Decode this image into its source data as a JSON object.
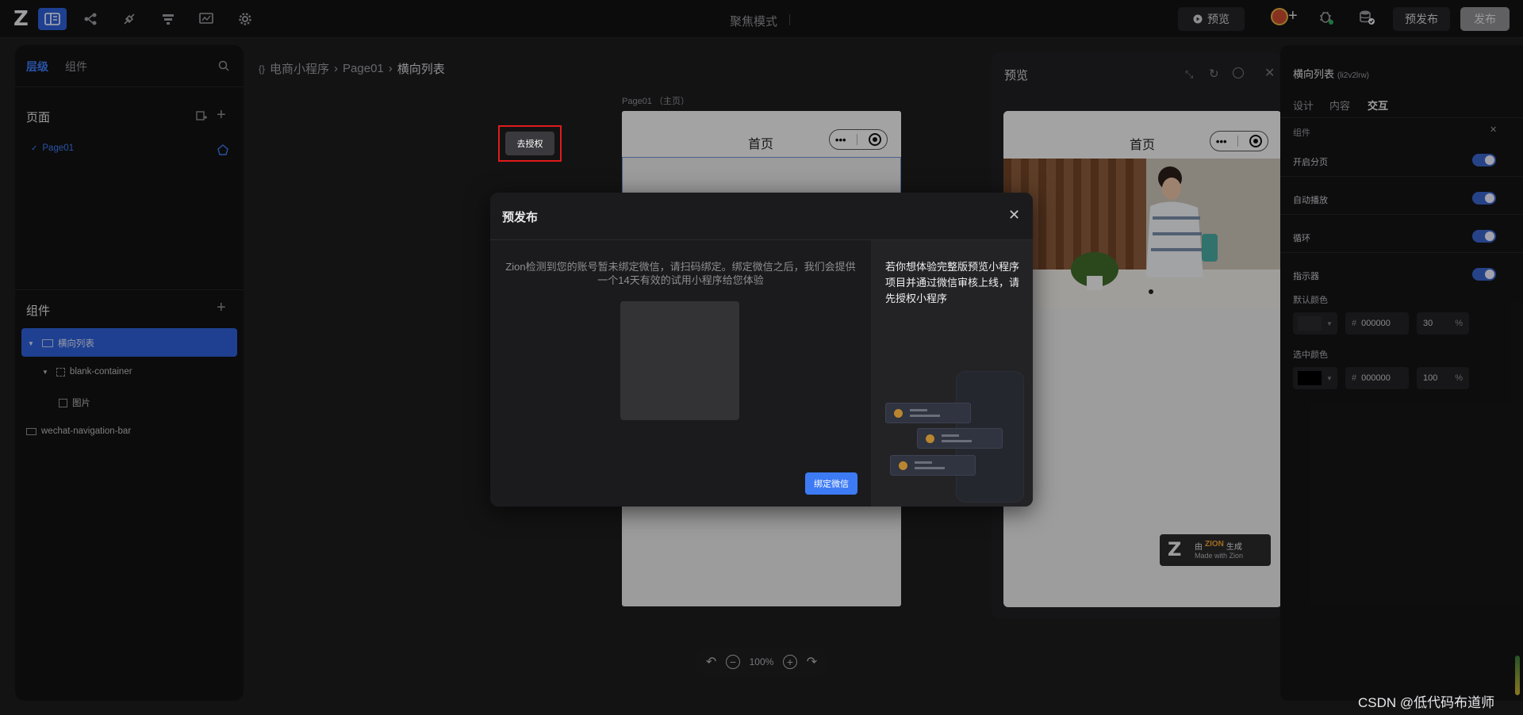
{
  "topbar": {
    "logo": "Z",
    "focus_mode": "聚焦模式",
    "preview_label": "预览",
    "prepublish_label": "预发布",
    "publish_label": "发布"
  },
  "left_panel": {
    "tabs": [
      "层级",
      "组件"
    ],
    "pages_title": "页面",
    "page_item": "Page01",
    "components_title": "组件",
    "tree": [
      "横向列表",
      "blank-container",
      "图片",
      "wechat-navigation-bar"
    ]
  },
  "canvas": {
    "breadcrumb": [
      "电商小程序",
      "Page01",
      "横向列表"
    ],
    "page_label": "Page01 （主页）",
    "nav_title": "首页",
    "zoom": "100%"
  },
  "preview": {
    "title": "预览",
    "nav_title": "首页",
    "badge_prefix": "由",
    "badge_brand": "ZION",
    "badge_suffix": "生成",
    "badge_sub": "Made with Zion"
  },
  "right_panel": {
    "title": "横向列表",
    "title_id": "(li2v2lrw)",
    "tabs": [
      "设计",
      "内容",
      "交互"
    ],
    "section": "组件",
    "toggles": [
      "开启分页",
      "自动播放",
      "循环",
      "指示器"
    ],
    "default_color_label": "默认颜色",
    "default_color_hex": "000000",
    "default_opacity": "30",
    "selected_color_label": "选中颜色",
    "selected_color_hex": "000000",
    "selected_opacity": "100",
    "hash": "#",
    "percent": "%"
  },
  "modal": {
    "title": "预发布",
    "message": "Zion检测到您的账号暂未绑定微信，请扫码绑定。绑定微信之后，我们会提供一个14天有效的试用小程序给您体验",
    "bind_button": "绑定微信",
    "right_text": "若你想体验完整版预览小程序项目并通过微信审核上线，请先授权小程序",
    "auth_button": "去授权"
  },
  "watermark": "CSDN @低代码布道师",
  "colors": {
    "accent": "#2f5fd6",
    "highlight": "#e01b1b",
    "toggle": "#3a63c9"
  }
}
